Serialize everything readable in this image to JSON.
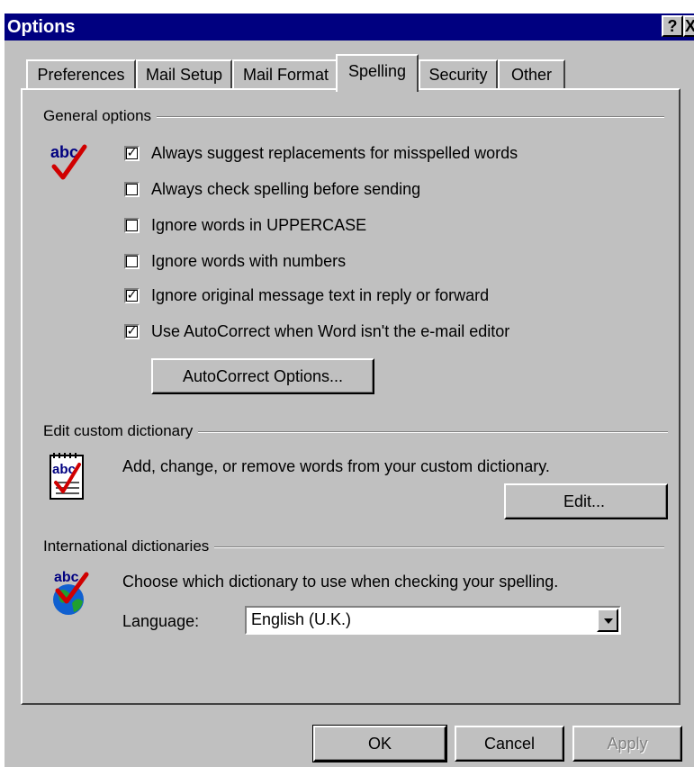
{
  "window": {
    "title": "Options",
    "help_label": "?",
    "close_label": "X"
  },
  "tabs": [
    {
      "label": "Preferences",
      "active": false
    },
    {
      "label": "Mail Setup",
      "active": false
    },
    {
      "label": "Mail Format",
      "active": false
    },
    {
      "label": "Spelling",
      "active": true
    },
    {
      "label": "Security",
      "active": false
    },
    {
      "label": "Other",
      "active": false
    }
  ],
  "general": {
    "heading": "General options",
    "icon": "abc-check-icon",
    "options": [
      {
        "label": "Always suggest replacements for misspelled words",
        "checked": true
      },
      {
        "label": "Always check spelling before sending",
        "checked": false
      },
      {
        "label": "Ignore words in UPPERCASE",
        "checked": false
      },
      {
        "label": "Ignore words with numbers",
        "checked": false
      },
      {
        "label": "Ignore original message text in reply or forward",
        "checked": true
      },
      {
        "label": "Use AutoCorrect when Word isn't the e-mail editor",
        "checked": true
      }
    ],
    "autocorrect_button": "AutoCorrect Options..."
  },
  "custom_dictionary": {
    "heading": "Edit custom dictionary",
    "icon": "dictionary-notepad-icon",
    "description": "Add, change, or remove words from your custom dictionary.",
    "edit_button": "Edit..."
  },
  "international": {
    "heading": "International dictionaries",
    "icon": "globe-abc-icon",
    "description": "Choose which dictionary to use when checking your spelling.",
    "language_label": "Language:",
    "language_value": "English (U.K.)"
  },
  "footer": {
    "ok": "OK",
    "cancel": "Cancel",
    "apply": "Apply",
    "apply_enabled": false
  },
  "colors": {
    "titlebar": "#000080",
    "face": "#c0c0c0",
    "check_red": "#d00000",
    "abc_blue": "#000080"
  }
}
